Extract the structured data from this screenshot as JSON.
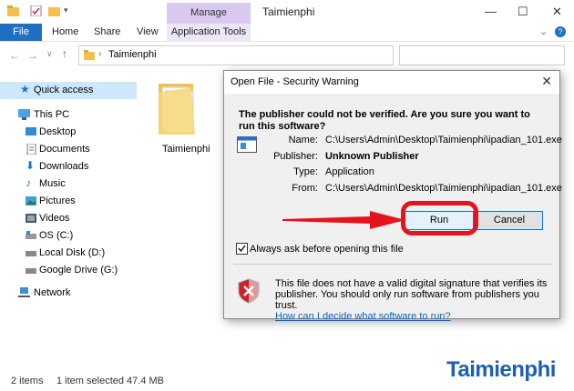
{
  "window": {
    "title": "Taimienphi",
    "manage_label": "Manage",
    "minimize": "—",
    "maximize": "☐",
    "close": "✕"
  },
  "ribbon": {
    "tabs": [
      "File",
      "Home",
      "Share",
      "View",
      "Application Tools"
    ],
    "help": "?"
  },
  "address": {
    "path": "Taimienphi"
  },
  "sidebar": {
    "items": [
      {
        "label": "Quick access",
        "icon": "star-icon"
      },
      {
        "label": "This PC",
        "icon": "pc-icon"
      },
      {
        "label": "Desktop",
        "icon": "desktop-icon"
      },
      {
        "label": "Documents",
        "icon": "documents-icon"
      },
      {
        "label": "Downloads",
        "icon": "downloads-icon"
      },
      {
        "label": "Music",
        "icon": "music-icon"
      },
      {
        "label": "Pictures",
        "icon": "pictures-icon"
      },
      {
        "label": "Videos",
        "icon": "videos-icon"
      },
      {
        "label": "OS (C:)",
        "icon": "drive-icon"
      },
      {
        "label": "Local Disk (D:)",
        "icon": "drive-icon"
      },
      {
        "label": "Google Drive (G:)",
        "icon": "drive-icon"
      },
      {
        "label": "Network",
        "icon": "network-icon"
      }
    ]
  },
  "content": {
    "folder_name": "Taimienphi"
  },
  "status": {
    "count": "2 items",
    "selected": "1 item selected  47.4 MB"
  },
  "dialog": {
    "title": "Open File - Security Warning",
    "question": "The publisher could not be verified.  Are you sure you want to run this software?",
    "fields": {
      "name_key": "Name:",
      "name_val": "C:\\Users\\Admin\\Desktop\\Taimienphi\\ipadian_101.exe",
      "publisher_key": "Publisher:",
      "publisher_val": "Unknown Publisher",
      "type_key": "Type:",
      "type_val": "Application",
      "from_key": "From:",
      "from_val": "C:\\Users\\Admin\\Desktop\\Taimienphi\\ipadian_101.exe"
    },
    "run_label": "Run",
    "cancel_label": "Cancel",
    "always_ask": "Always ask before opening this file",
    "always_ask_checked": true,
    "warning": "This file does not have a valid digital signature that verifies its publisher. You should only run software from publishers you trust.",
    "link": "How can I decide what software to run?"
  },
  "watermark": "Taimienphi",
  "colors": {
    "accent": "#1f6fc2",
    "highlight_red": "#e5141c",
    "manage_tab": "#d9c9f0"
  }
}
